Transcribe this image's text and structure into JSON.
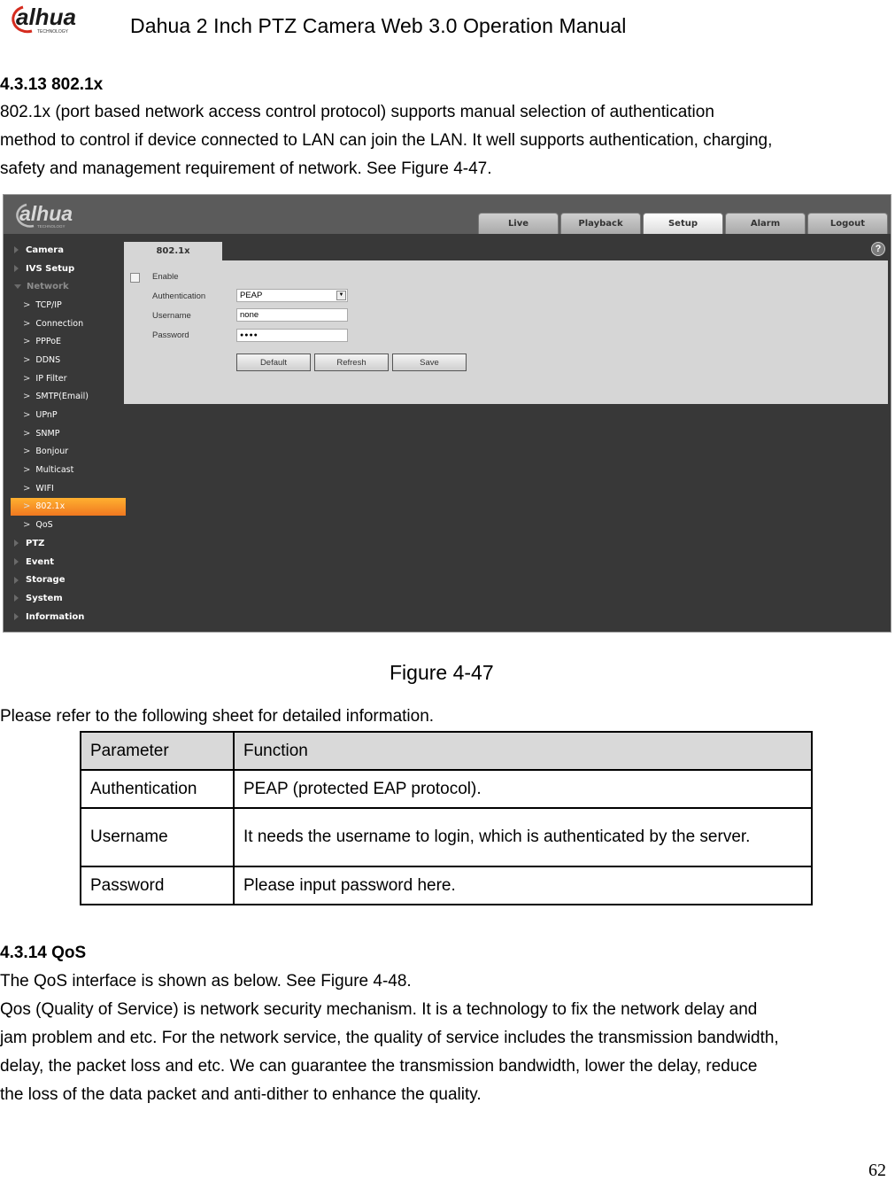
{
  "header": {
    "brand": "alhua",
    "brand_sub": "TECHNOLOGY",
    "title": "Dahua 2 Inch PTZ Camera Web 3.0 Operation Manual"
  },
  "section1": {
    "heading": "4.3.13 802.1x",
    "lines": [
      "802.1x (port based network access control protocol) supports manual selection of authentication",
      "method to control if device connected to LAN can join the LAN. It well supports authentication, charging,",
      "safety and management requirement of network. See Figure 4-47."
    ]
  },
  "figure": {
    "logo": "alhua",
    "logo_sub": "TECHNOLOGY",
    "tabs": [
      {
        "label": "Live",
        "active": false
      },
      {
        "label": "Playback",
        "active": false
      },
      {
        "label": "Setup",
        "active": true
      },
      {
        "label": "Alarm",
        "active": false
      },
      {
        "label": "Logout",
        "active": false
      }
    ],
    "sidebar": {
      "top_before": [
        "Camera",
        "IVS Setup"
      ],
      "open_group": "Network",
      "sub_items": [
        "TCP/IP",
        "Connection",
        "PPPoE",
        "DDNS",
        "IP Filter",
        "SMTP(Email)",
        "UPnP",
        "SNMP",
        "Bonjour",
        "Multicast",
        "WIFI",
        "802.1x",
        "QoS"
      ],
      "selected": "802.1x",
      "top_after": [
        "PTZ",
        "Event",
        "Storage",
        "System",
        "Information"
      ]
    },
    "panel_tab": "802.1x",
    "help": "?",
    "form": {
      "enable_label": "Enable",
      "enable_checked": false,
      "auth_label": "Authentication",
      "auth_value": "PEAP",
      "username_label": "Username",
      "username_value": "none",
      "password_label": "Password",
      "password_value": "●●●●",
      "buttons": [
        "Default",
        "Refresh",
        "Save"
      ]
    },
    "accent_color": "#f58a25",
    "caption": "Figure 4-47"
  },
  "table_intro": "Please refer to the following sheet for detailed information.",
  "table": {
    "headers": [
      "Parameter",
      "Function"
    ],
    "rows": [
      [
        "Authentication",
        "PEAP (protected EAP protocol)."
      ],
      [
        "Username",
        "It needs the username to login, which is authenticated by the server."
      ],
      [
        "Password",
        "Please input password here."
      ]
    ]
  },
  "section2": {
    "heading": "4.3.14 QoS",
    "lines": [
      "The QoS interface is shown as below. See Figure 4-48.",
      "Qos (Quality of Service) is network security mechanism. It is a technology to fix the network delay and",
      "jam problem and etc. For the network service, the quality of service includes the transmission bandwidth,",
      "delay, the packet loss and etc. We can guarantee the transmission bandwidth, lower the delay, reduce",
      "the loss of the data packet and anti-dither to enhance the quality."
    ]
  },
  "page_number": "62"
}
